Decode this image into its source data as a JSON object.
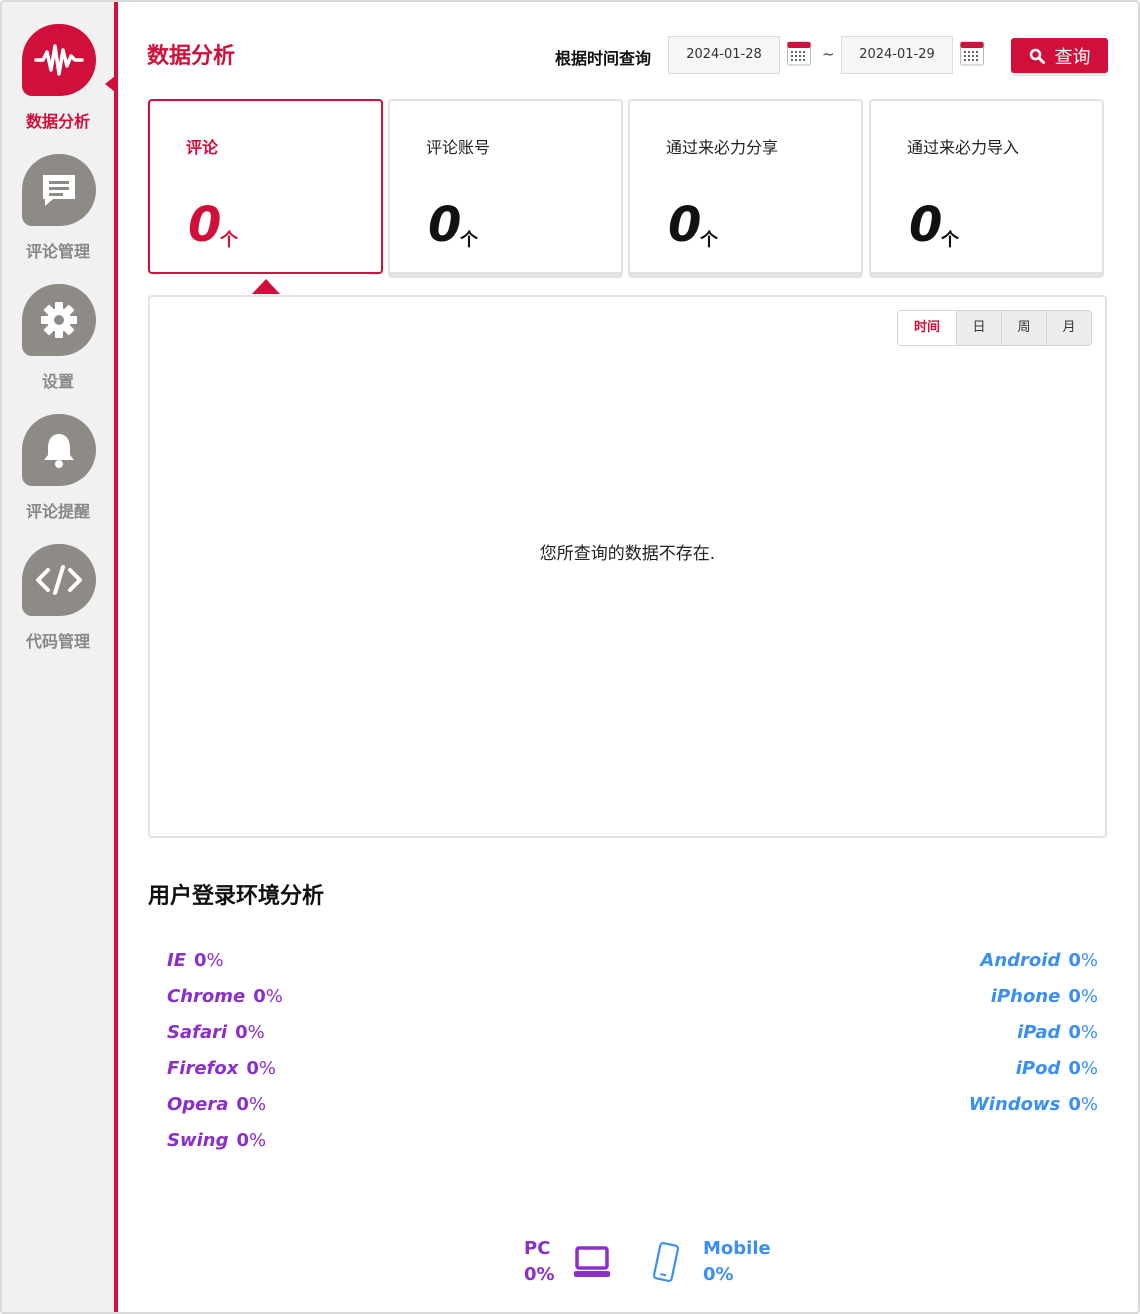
{
  "sidebar": {
    "items": [
      {
        "label": "数据分析",
        "icon": "waveform-icon",
        "active": true
      },
      {
        "label": "评论管理",
        "icon": "comment-icon",
        "active": false
      },
      {
        "label": "设置",
        "icon": "gear-icon",
        "active": false
      },
      {
        "label": "评论提醒",
        "icon": "bell-icon",
        "active": false
      },
      {
        "label": "代码管理",
        "icon": "code-icon",
        "active": false
      }
    ]
  },
  "header": {
    "title": "数据分析",
    "query_label": "根据时间查询",
    "start_date": "2024-01-28",
    "separator": "~",
    "end_date": "2024-01-29",
    "search_label": "查询"
  },
  "cards": [
    {
      "label": "评论",
      "value": "0",
      "unit": "个"
    },
    {
      "label": "评论账号",
      "value": "0",
      "unit": "个"
    },
    {
      "label": "通过来必力分享",
      "value": "0",
      "unit": "个"
    },
    {
      "label": "通过来必力导入",
      "value": "0",
      "unit": "个"
    }
  ],
  "chart_panel": {
    "tabs": [
      "时间",
      "日",
      "周",
      "月"
    ],
    "empty_message": "您所查询的数据不存在."
  },
  "env": {
    "title": "用户登录环境分析",
    "browsers": [
      {
        "name": "IE",
        "value": "0",
        "unit": "%"
      },
      {
        "name": "Chrome",
        "value": "0",
        "unit": "%"
      },
      {
        "name": "Safari",
        "value": "0",
        "unit": "%"
      },
      {
        "name": "Firefox",
        "value": "0",
        "unit": "%"
      },
      {
        "name": "Opera",
        "value": "0",
        "unit": "%"
      },
      {
        "name": "Swing",
        "value": "0",
        "unit": "%"
      }
    ],
    "devices": [
      {
        "name": "Android",
        "value": "0",
        "unit": "%"
      },
      {
        "name": "iPhone",
        "value": "0",
        "unit": "%"
      },
      {
        "name": "iPad",
        "value": "0",
        "unit": "%"
      },
      {
        "name": "iPod",
        "value": "0",
        "unit": "%"
      },
      {
        "name": "Windows",
        "value": "0",
        "unit": "%"
      }
    ],
    "pc": {
      "label": "PC",
      "value": "0%"
    },
    "mobile": {
      "label": "Mobile",
      "value": "0%"
    }
  },
  "colors": {
    "accent": "#d0103a",
    "sidebar_bg": "#f1f1f1",
    "icon_gray": "#8e8a86",
    "browser_purple": "#8b2fc9",
    "device_blue": "#3b8ff0"
  }
}
